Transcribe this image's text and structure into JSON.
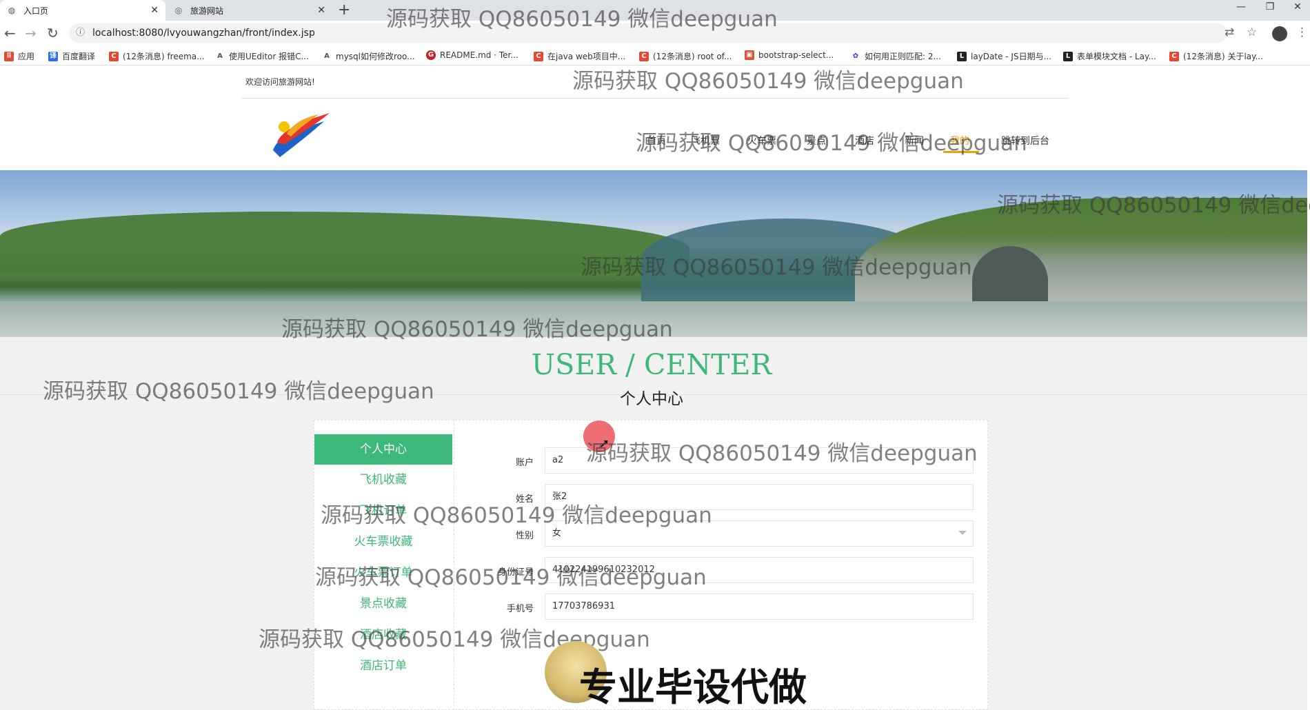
{
  "browser": {
    "tabs": [
      {
        "title": "入口页",
        "active": true
      },
      {
        "title": "旅游网站",
        "active": false
      }
    ],
    "url": "localhost:8080/lvyouwangzhan/front/index.jsp",
    "bookmarks": [
      {
        "label": "应用",
        "icon": "apps-icon",
        "color": "#e04a3a"
      },
      {
        "label": "百度翻译",
        "icon": "baidu-translate-icon",
        "color": "#2a6df4"
      },
      {
        "label": "(12条消息) freema...",
        "icon": "csdn-icon",
        "color": "#e8472f"
      },
      {
        "label": "使用UEditor 报错C...",
        "icon": "bookmark-icon",
        "color": "#555555"
      },
      {
        "label": "mysql如何修改roo...",
        "icon": "bookmark-icon",
        "color": "#555555"
      },
      {
        "label": "README.md · Ter...",
        "icon": "gitee-icon",
        "color": "#c71d23"
      },
      {
        "label": "在java web项目中...",
        "icon": "csdn-icon",
        "color": "#e8472f"
      },
      {
        "label": "(12条消息) root of...",
        "icon": "csdn-icon",
        "color": "#e8472f"
      },
      {
        "label": "bootstrap-select...",
        "icon": "bookmark-icon",
        "color": "#e05030"
      },
      {
        "label": "如何用正则匹配: 2...",
        "icon": "baidu-icon",
        "color": "#2a3cdb"
      },
      {
        "label": "layDate - JS日期与...",
        "icon": "layui-icon",
        "color": "#222222"
      },
      {
        "label": "表单模块文档 - Lay...",
        "icon": "layui-icon",
        "color": "#222222"
      },
      {
        "label": "(12条消息) 关于lay...",
        "icon": "csdn-icon",
        "color": "#e8472f"
      }
    ]
  },
  "header": {
    "welcome": "欢迎访问旅游网站!",
    "nav": [
      {
        "label": "首页",
        "active": false
      },
      {
        "label": "飞机票",
        "active": false
      },
      {
        "label": "火车票",
        "active": false
      },
      {
        "label": "景点",
        "active": false
      },
      {
        "label": "酒店",
        "active": false
      },
      {
        "label": "新闻",
        "active": false
      },
      {
        "label": "我的",
        "active": true
      },
      {
        "label": "跳转到后台",
        "active": false
      }
    ]
  },
  "section": {
    "title": "USER / CENTER",
    "subtitle": "个人中心"
  },
  "sidebar": {
    "items": [
      {
        "label": "个人中心",
        "active": true
      },
      {
        "label": "飞机收藏",
        "active": false
      },
      {
        "label": "飞机订单",
        "active": false
      },
      {
        "label": "火车票收藏",
        "active": false
      },
      {
        "label": "火车票订单",
        "active": false
      },
      {
        "label": "景点收藏",
        "active": false
      },
      {
        "label": "酒店收藏",
        "active": false
      },
      {
        "label": "酒店订单",
        "active": false
      }
    ]
  },
  "form": {
    "account": {
      "label": "账户",
      "value": "a2"
    },
    "name": {
      "label": "姓名",
      "value": "张2"
    },
    "gender": {
      "label": "性别",
      "value": "女"
    },
    "idcard": {
      "label": "身份证号",
      "value": "410224199610232012"
    },
    "phone": {
      "label": "手机号",
      "value": "17703786931"
    }
  },
  "watermark": "源码获取 QQ86050149 微信deepguan",
  "ad_text": "专业毕设代做",
  "colors": {
    "accent": "#3cb878",
    "nav_active": "#f0a000"
  }
}
